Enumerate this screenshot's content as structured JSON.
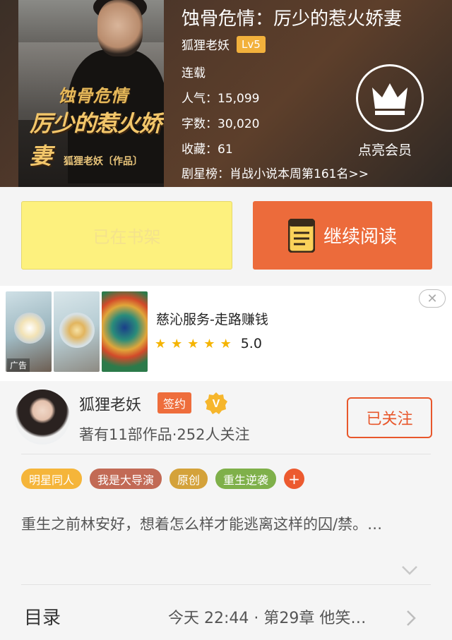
{
  "book": {
    "title": "蚀骨危情：厉少的惹火娇妻",
    "author": "狐狸老妖",
    "level": "Lv5",
    "status": "连载",
    "popularity": "人气：15,099",
    "word_count": "字数：30,020",
    "favorites": "收藏：61",
    "ranking": "剧星榜：肖战小说本周第161名>>",
    "cover": {
      "line1": "蚀骨危情",
      "line2": "厉少的惹火娇妻",
      "line3": "狐狸老妖〔作品〕"
    }
  },
  "membership": {
    "label": "点亮会员"
  },
  "actions": {
    "shelf_label": "已在书架",
    "read_label": "继续阅读"
  },
  "ad": {
    "title": "慈沁服务-走路赚钱",
    "rating": "5.0",
    "stars": 5,
    "tag": "广告"
  },
  "author_card": {
    "name": "狐狸老妖",
    "sign_badge": "签约",
    "stats": "著有11部作品·252人关注",
    "follow_label": "已关注"
  },
  "tags": [
    {
      "label": "明星同人",
      "color": "#f5b53a"
    },
    {
      "label": "我是大导演",
      "color": "#c26a55"
    },
    {
      "label": "原创",
      "color": "#d4a23a"
    },
    {
      "label": "重生逆袭",
      "color": "#7fb04a"
    }
  ],
  "description": "重生之前林安好，想着怎么样才能逃离这样的囚/禁。…",
  "toc": {
    "label": "目录",
    "latest": "今天 22:44 · 第29章 他笑…"
  },
  "colors": {
    "accent": "#ec6b3b",
    "shelf": "#fdf17e",
    "level": "#f2b13c"
  }
}
